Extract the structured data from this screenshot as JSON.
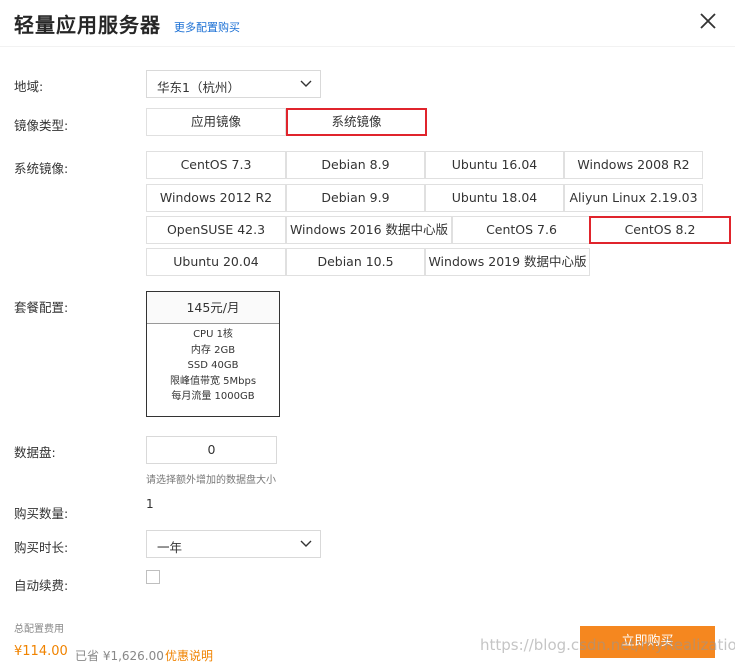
{
  "header": {
    "title": "轻量应用服务器",
    "more_link": "更多配置购买",
    "close_icon": "close-icon"
  },
  "region": {
    "label": "地域:",
    "value": "华东1（杭州）"
  },
  "image_type": {
    "label": "镜像类型:",
    "options": [
      "应用镜像",
      "系统镜像"
    ],
    "selected": "系统镜像"
  },
  "system_image": {
    "label": "系统镜像:",
    "rows": [
      [
        "CentOS 7.3",
        "Debian 8.9",
        "Ubuntu 16.04",
        "Windows 2008 R2"
      ],
      [
        "Windows 2012 R2",
        "Debian 9.9",
        "Ubuntu 18.04",
        "Aliyun Linux 2.19.03"
      ],
      [
        "OpenSUSE 42.3",
        "Windows 2016 数据中心版",
        "CentOS 7.6",
        "CentOS 8.2"
      ],
      [
        "Ubuntu 20.04",
        "Debian 10.5",
        "Windows 2019 数据中心版"
      ]
    ],
    "selected": "CentOS 8.2"
  },
  "plan": {
    "label": "套餐配置:",
    "price": "145元/月",
    "specs": [
      "CPU 1核",
      "内存 2GB",
      "SSD 40GB",
      "限峰值带宽 5Mbps",
      "每月流量 1000GB"
    ]
  },
  "data_disk": {
    "label": "数据盘:",
    "value": "0",
    "hint": "请选择额外增加的数据盘大小"
  },
  "quantity": {
    "label": "购买数量:",
    "value": "1"
  },
  "duration": {
    "label": "购买时长:",
    "value": "一年"
  },
  "auto_renew": {
    "label": "自动续费:",
    "checked": false
  },
  "footer": {
    "total_label": "总配置费用",
    "price": "¥114.00",
    "saved": "已省 ¥1,626.00",
    "promo_link": "优惠说明",
    "buy_button": "立即购买",
    "watermark": "https://blog.csdn.net/myRealization"
  },
  "colors": {
    "accent": "#f5871f",
    "selected_border": "#e0242c",
    "link": "#1a6fd4",
    "price": "#f08300"
  }
}
